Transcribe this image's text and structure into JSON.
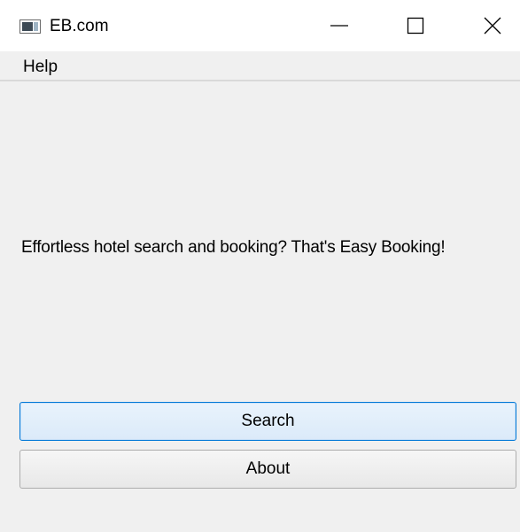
{
  "window": {
    "title": "EB.com",
    "icon": "app-window-icon",
    "controls": {
      "minimize_icon": "minimize-icon",
      "maximize_icon": "maximize-icon",
      "close_icon": "close-icon"
    }
  },
  "menubar": {
    "items": [
      {
        "label": "Help"
      }
    ]
  },
  "main": {
    "tagline": "Effortless hotel search and booking? That's Easy Booking!",
    "buttons": {
      "search_label": "Search",
      "about_label": "About"
    }
  },
  "colors": {
    "window_bg": "#f0f0f0",
    "titlebar_bg": "#ffffff",
    "focus_border": "#0078d7",
    "button_border": "#adadad"
  }
}
